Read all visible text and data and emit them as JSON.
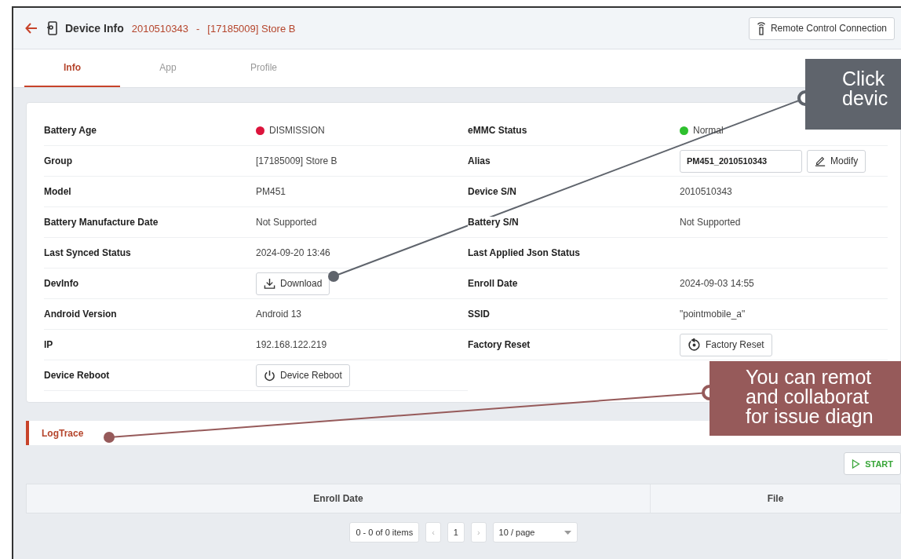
{
  "header": {
    "title": "Device Info",
    "serial": "2010510343",
    "separator": "-",
    "group": "[17185009] Store B",
    "remote_button": "Remote Control Connection"
  },
  "tabs": [
    {
      "label": "Info",
      "selected": true
    },
    {
      "label": "App",
      "selected": false
    },
    {
      "label": "Profile",
      "selected": false
    }
  ],
  "info_left": [
    {
      "label": "Battery Age",
      "kind": "status",
      "value": "DISMISSION",
      "color": "#dc143c"
    },
    {
      "label": "Group",
      "kind": "text",
      "value": "[17185009] Store B"
    },
    {
      "label": "Model",
      "kind": "text",
      "value": "PM451"
    },
    {
      "label": "Battery Manufacture Date",
      "kind": "text",
      "value": "Not Supported"
    },
    {
      "label": "Last Synced Status",
      "kind": "text",
      "value": "2024-09-20 13:46"
    },
    {
      "label": "DevInfo",
      "kind": "download",
      "value": "Download"
    },
    {
      "label": "Android Version",
      "kind": "text",
      "value": "Android 13"
    },
    {
      "label": "IP",
      "kind": "text",
      "value": "192.168.122.219"
    },
    {
      "label": "Device Reboot",
      "kind": "reboot",
      "value": "Device Reboot"
    }
  ],
  "info_right": [
    {
      "label": "eMMC Status",
      "kind": "status",
      "value": "Normal",
      "color": "#2ec02e"
    },
    {
      "label": "Alias",
      "kind": "alias",
      "value": "PM451_2010510343",
      "button": "Modify"
    },
    {
      "label": "Device S/N",
      "kind": "text",
      "value": "2010510343"
    },
    {
      "label": "Battery S/N",
      "kind": "text",
      "value": "Not Supported"
    },
    {
      "label": "Last Applied Json Status",
      "kind": "text"
    },
    {
      "label": "Enroll Date",
      "kind": "text",
      "value": "2024-09-03 14:55"
    },
    {
      "label": "SSID",
      "kind": "text",
      "value": "\"pointmobile_a\""
    },
    {
      "label": "Factory Reset",
      "kind": "reset",
      "value": "Factory Reset"
    }
  ],
  "logtrace": {
    "title": "LogTrace",
    "start_button": "START",
    "columns": [
      "Enroll Date",
      "File"
    ],
    "pagination": {
      "summary": "0 - 0 of 0 items",
      "prev": "‹",
      "page": "1",
      "next": "›",
      "page_size": "10 / page"
    }
  },
  "callouts": [
    {
      "lines": [
        "Click",
        "devic"
      ],
      "color": "#5f646c"
    },
    {
      "lines": [
        "You can remot",
        "and collaborat",
        "for issue diagn"
      ],
      "color": "#965a5a"
    }
  ]
}
